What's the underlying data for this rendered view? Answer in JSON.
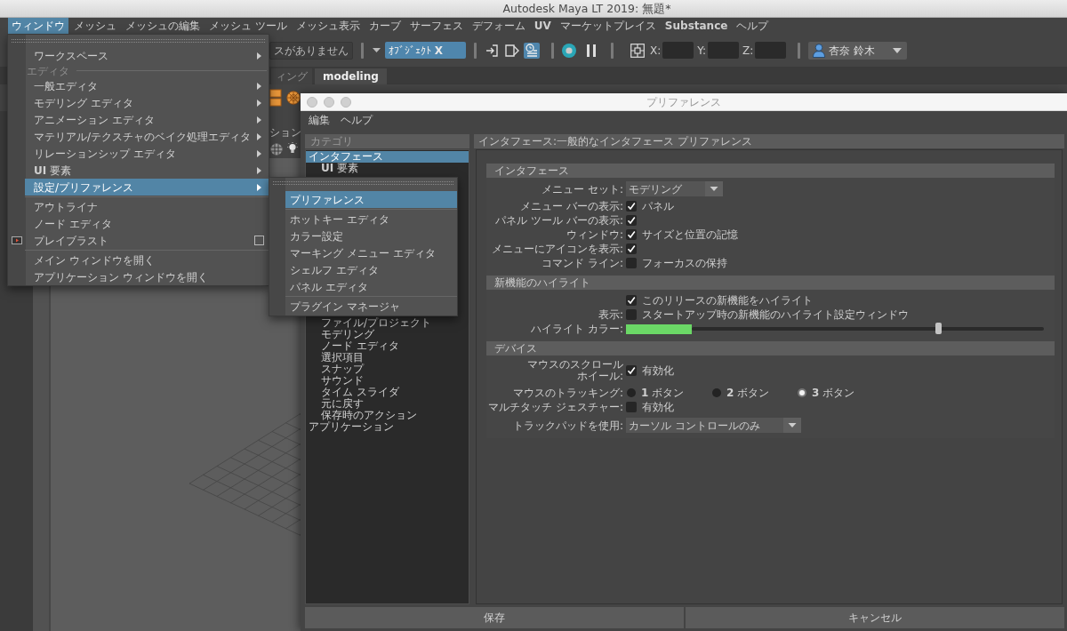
{
  "app_window": {
    "title": "Autodesk Maya LT 2019: 無題*"
  },
  "menu_bar": [
    {
      "label": "ウィンドウ",
      "selected": true,
      "bold": false
    },
    {
      "label": "メッシュ",
      "selected": false,
      "bold": false
    },
    {
      "label": "メッシュの編集",
      "selected": false,
      "bold": false
    },
    {
      "label": "メッシュ ツール",
      "selected": false,
      "bold": false
    },
    {
      "label": "メッシュ表示",
      "selected": false,
      "bold": false
    },
    {
      "label": "カーブ",
      "selected": false,
      "bold": false
    },
    {
      "label": "サーフェス",
      "selected": false,
      "bold": false
    },
    {
      "label": "デフォーム",
      "selected": false,
      "bold": false
    },
    {
      "label": "UV",
      "selected": false,
      "bold": true
    },
    {
      "label": "マーケットプレイス",
      "selected": false,
      "bold": false
    },
    {
      "label": "Substance",
      "selected": false,
      "bold": true
    },
    {
      "label": "ヘルプ",
      "selected": false,
      "bold": false
    }
  ],
  "status_line": {
    "partial_button": "スがありません",
    "selection_field": "ｵﾌﾞｼﾞｪｸﾄ **X**",
    "toggles": [
      {
        "selected": false
      },
      {
        "selected": false
      },
      {
        "selected": true
      }
    ],
    "coordinates": [
      {
        "label": "X:"
      },
      {
        "label": "Y:"
      },
      {
        "label": "Z:"
      }
    ],
    "user": "杏奈 鈴木"
  },
  "shelf_tabs": [
    {
      "label": "ィング",
      "selected": false
    },
    {
      "label": "modeling",
      "selected": true
    }
  ],
  "panel_menu": {
    "partial_label": "ション"
  },
  "window_menu": {
    "items": [
      {
        "kind": "submenu_item",
        "label": "ワークスペース",
        "selected": false
      },
      {
        "kind": "section",
        "label": "エディタ"
      },
      {
        "kind": "submenu_item",
        "label": "一般エディタ",
        "selected": false
      },
      {
        "kind": "submenu_item",
        "label": "モデリング エディタ",
        "selected": false
      },
      {
        "kind": "submenu_item",
        "label": "アニメーション エディタ",
        "selected": false
      },
      {
        "kind": "submenu_item",
        "label": "マテリアル/テクスチャのベイク処理エディタ",
        "selected": false
      },
      {
        "kind": "submenu_item",
        "label": "リレーションシップ エディタ",
        "selected": false
      },
      {
        "kind": "submenu_item",
        "label": "**UI** 要素",
        "selected": false
      },
      {
        "kind": "submenu_item",
        "label": "設定/プリファレンス",
        "selected": true
      },
      {
        "kind": "separator"
      },
      {
        "kind": "item",
        "label": "アウトライナ",
        "selected": false
      },
      {
        "kind": "item",
        "label": "ノード エディタ",
        "selected": false
      },
      {
        "kind": "tool_item",
        "label": "プレイブラスト",
        "selected": false
      },
      {
        "kind": "separator"
      },
      {
        "kind": "item",
        "label": "メイン ウィンドウを開く",
        "selected": false
      },
      {
        "kind": "item",
        "label": "アプリケーション ウィンドウを開く",
        "selected": false
      }
    ]
  },
  "settings_submenu": {
    "items": [
      {
        "kind": "item",
        "label": "プリファレンス",
        "selected": true
      },
      {
        "kind": "separator"
      },
      {
        "kind": "item",
        "label": "ホットキー エディタ",
        "selected": false
      },
      {
        "kind": "item",
        "label": "カラー設定",
        "selected": false
      },
      {
        "kind": "item",
        "label": "マーキング メニュー エディタ",
        "selected": false
      },
      {
        "kind": "item",
        "label": "シェルフ エディタ",
        "selected": false
      },
      {
        "kind": "item",
        "label": "パネル エディタ",
        "selected": false
      },
      {
        "kind": "separator"
      },
      {
        "kind": "item",
        "label": "プラグイン マネージャ",
        "selected": false
      }
    ]
  },
  "preferences": {
    "title": "プリファレンス",
    "menu": [
      "編集",
      "ヘルプ"
    ],
    "categories": {
      "header": "カテゴリ",
      "items": [
        {
          "label": "インタフェース",
          "selected": true,
          "children": [
            {
              "label": "**UI** 要素",
              "selected": false
            }
          ]
        },
        {
          "children": [
            {
              "label": "ファイル/プロジェクト",
              "selected": false
            },
            {
              "label": "モデリング",
              "selected": false
            },
            {
              "label": "ノード エディタ",
              "selected": false
            },
            {
              "label": "選択項目",
              "selected": false
            },
            {
              "label": "スナップ",
              "selected": false
            },
            {
              "label": "サウンド",
              "selected": false
            },
            {
              "label": "タイム スライダ",
              "selected": false
            },
            {
              "label": "元に戻す",
              "selected": false
            },
            {
              "label": "保存時のアクション",
              "selected": false
            }
          ]
        },
        {
          "label": "アプリケーション",
          "selected": false
        }
      ]
    },
    "panel": {
      "header": "インタフェース:一般的なインタフェース プリファレンス",
      "sections": [
        {
          "title": "インタフェース",
          "rows": [
            {
              "kind": "dropdown",
              "label": "メニュー セット:",
              "value": "モデリング"
            },
            {
              "kind": "checkbox",
              "label": "メニュー バーの表示:",
              "checked": true,
              "text": "パネル"
            },
            {
              "kind": "checkbox",
              "label": "パネル ツール バーの表示:",
              "checked": true
            },
            {
              "kind": "checkbox",
              "label": "ウィンドウ:",
              "checked": true,
              "text": "サイズと位置の記憶"
            },
            {
              "kind": "checkbox",
              "label": "メニューにアイコンを表示:",
              "checked": true
            },
            {
              "kind": "checkbox",
              "label": "コマンド ライン:",
              "checked": false,
              "text": "フォーカスの保持"
            }
          ]
        },
        {
          "title": "新機能のハイライト",
          "rows": [
            {
              "kind": "checkbox",
              "checked": true,
              "text": "このリリースの新機能をハイライト"
            },
            {
              "kind": "checkbox",
              "label": "表示:",
              "checked": false,
              "text": "スタートアップ時の新機能のハイライト設定ウィンドウ"
            },
            {
              "kind": "color_slider",
              "label": "ハイライト カラー:",
              "color": "#6bd866",
              "level": 0.7
            }
          ]
        },
        {
          "title": "デバイス",
          "rows": [
            {
              "kind": "checkbox",
              "label_lines": [
                "マウスのスクロール",
                "ホイール:"
              ],
              "checked": true,
              "text": "有効化"
            },
            {
              "kind": "radio",
              "label": "マウスのトラッキング:",
              "options": [
                {
                  "label": "**1** ボタン",
                  "selected": false
                },
                {
                  "label": "**2** ボタン",
                  "selected": false
                },
                {
                  "label": "**3** ボタン",
                  "selected": true
                }
              ]
            },
            {
              "kind": "checkbox",
              "label": "マルチタッチ ジェスチャー:",
              "checked": false,
              "text": "有効化"
            },
            {
              "kind": "dropdown",
              "label": "トラックパッドを使用:",
              "value": "カーソル コントロールのみ"
            }
          ]
        }
      ]
    },
    "buttons": [
      "保存",
      "キャンセル"
    ]
  }
}
